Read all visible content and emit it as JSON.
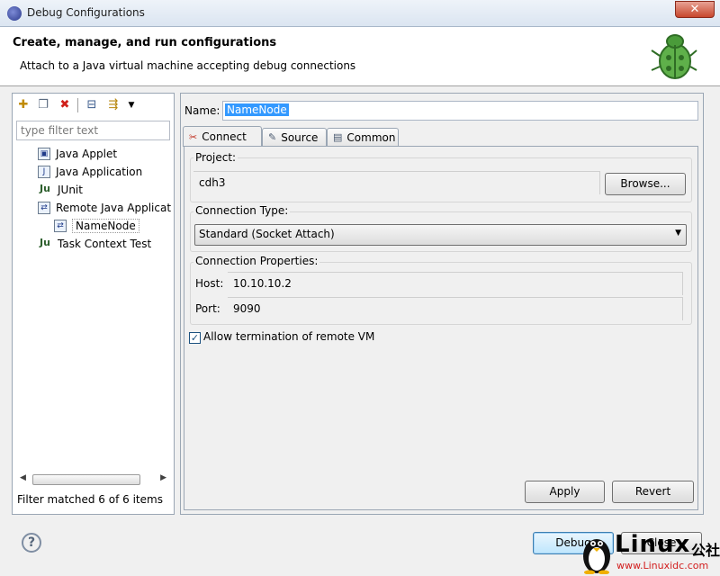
{
  "window": {
    "title": "Debug Configurations",
    "close_glyph": "✕"
  },
  "header": {
    "title": "Create, manage, and run configurations",
    "subtitle": "Attach to a Java virtual machine accepting debug connections",
    "banner_icon": "bug-icon"
  },
  "toolbar": {
    "icons": [
      "new-config-icon",
      "duplicate-icon",
      "delete-icon",
      "collapse-all-icon",
      "filter-icon",
      "dropdown-arrow-icon"
    ]
  },
  "sidebar": {
    "filter_placeholder": "type filter text",
    "items": [
      {
        "label": "Java Applet",
        "icon": "java-applet-icon"
      },
      {
        "label": "Java Application",
        "icon": "java-application-icon"
      },
      {
        "label": "JUnit",
        "icon": "junit-icon"
      },
      {
        "label": "Remote Java Applicat",
        "icon": "remote-java-icon"
      },
      {
        "label": "NameNode",
        "icon": "config-icon"
      },
      {
        "label": "Task Context Test",
        "icon": "junit-icon"
      }
    ],
    "status": "Filter matched 6 of 6 items"
  },
  "editor": {
    "name_label": "Name:",
    "name_value": "NameNode",
    "tabs": [
      {
        "label": "Connect",
        "icon": "connect-icon"
      },
      {
        "label": "Source",
        "icon": "source-icon"
      },
      {
        "label": "Common",
        "icon": "common-icon"
      }
    ],
    "project_label": "Project:",
    "project_value": "cdh3",
    "browse_label": "Browse...",
    "connection_type_label": "Connection Type:",
    "connection_type_value": "Standard (Socket Attach)",
    "connection_props_label": "Connection Properties:",
    "host_label": "Host:",
    "host_value": "10.10.10.2",
    "port_label": "Port:",
    "port_value": "9090",
    "allow_termination_label": "Allow termination of remote VM",
    "allow_termination_checked": true,
    "apply_label": "Apply",
    "revert_label": "Revert"
  },
  "footer": {
    "help_glyph": "?",
    "debug_label": "Debug",
    "close_label": "Close"
  },
  "watermark": {
    "text": "Linux",
    "cn": "公社",
    "url": "www.Linuxidc.com"
  }
}
